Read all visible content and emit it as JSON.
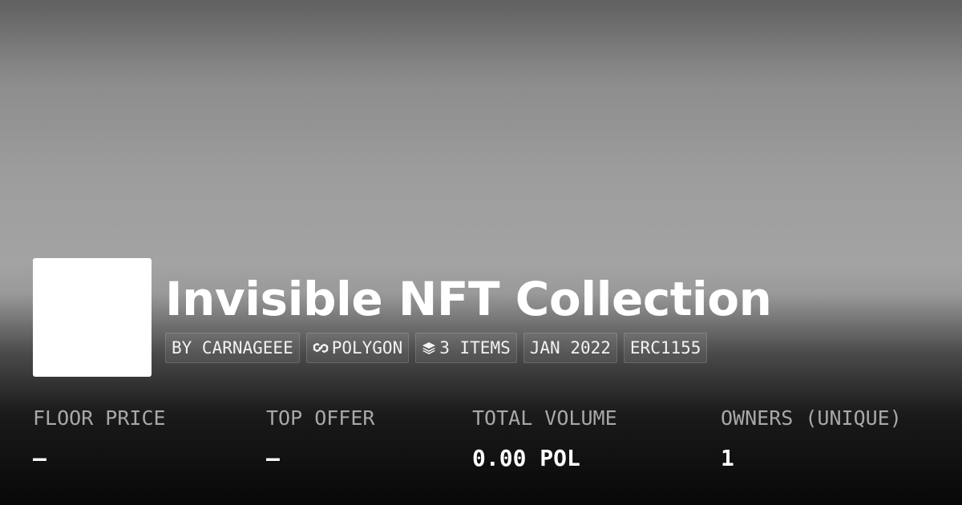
{
  "collection": {
    "title": "Invisible NFT Collection",
    "tags": {
      "creator": "BY CARNAGEEE",
      "chain": "POLYGON",
      "items": "3 ITEMS",
      "date": "JAN 2022",
      "standard": "ERC1155"
    },
    "chain_icon": "polygon-link-icon",
    "items_icon": "layers-icon"
  },
  "stats": [
    {
      "label": "FLOOR PRICE",
      "value": "—"
    },
    {
      "label": "TOP OFFER",
      "value": "—"
    },
    {
      "label": "TOTAL VOLUME",
      "value": "0.00 POL"
    },
    {
      "label": "OWNERS (UNIQUE)",
      "value": "1"
    }
  ]
}
